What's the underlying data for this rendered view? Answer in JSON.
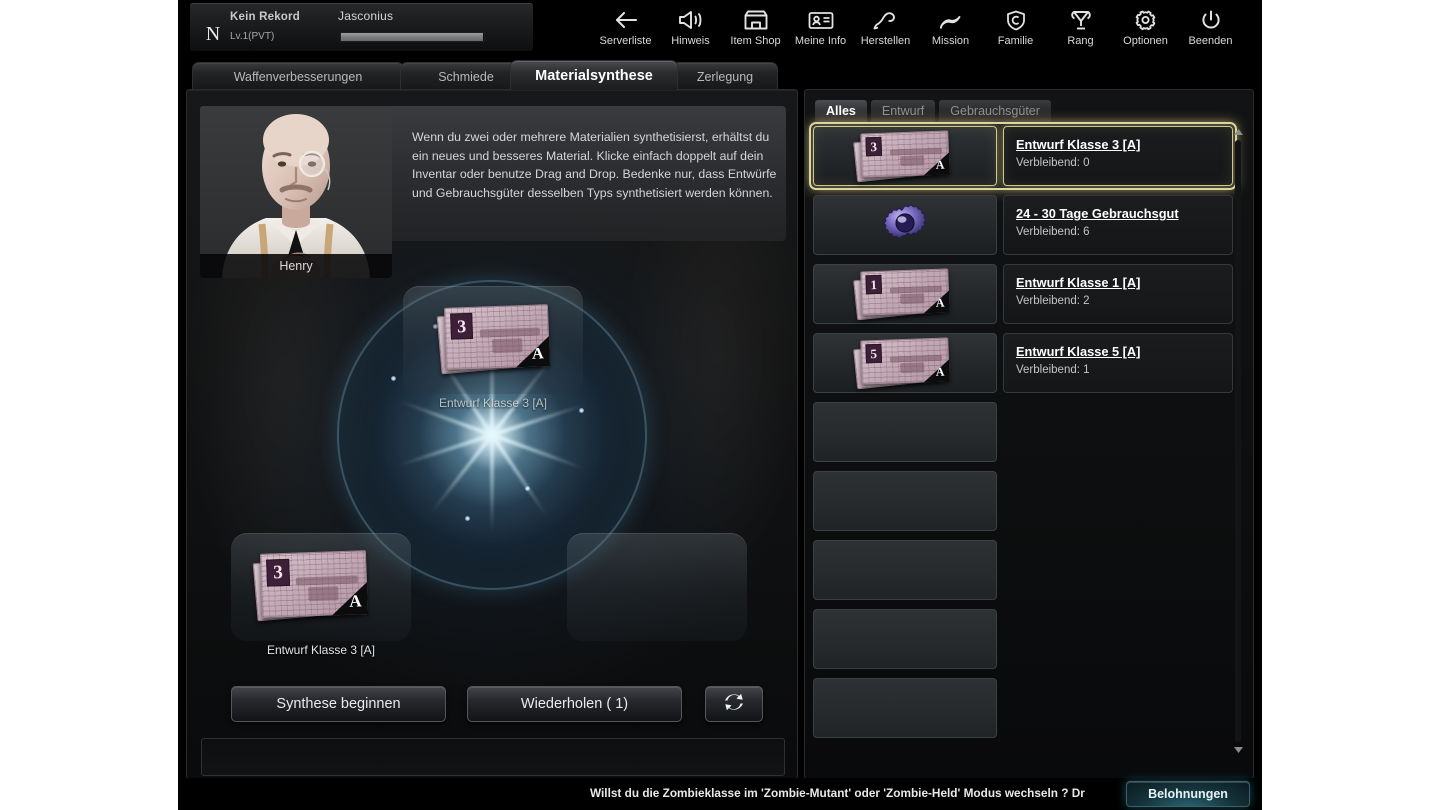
{
  "profile": {
    "rank_letter": "N",
    "record": "Kein Rekord",
    "level": "Lv.1(PVT)",
    "player_name": "Jasconius"
  },
  "nav": [
    {
      "icon": "back-arrow-icon",
      "label": "Serverliste"
    },
    {
      "icon": "megaphone-icon",
      "label": "Hinweis"
    },
    {
      "icon": "shop-icon",
      "label": "Item Shop"
    },
    {
      "icon": "id-card-icon",
      "label": "Meine Info"
    },
    {
      "icon": "hammer-icon",
      "label": "Herstellen"
    },
    {
      "icon": "flag-icon",
      "label": "Mission"
    },
    {
      "icon": "shield-c-icon",
      "label": "Familie"
    },
    {
      "icon": "trophy-icon",
      "label": "Rang"
    },
    {
      "icon": "gear-icon",
      "label": "Optionen"
    },
    {
      "icon": "power-icon",
      "label": "Beenden"
    }
  ],
  "tabs": [
    {
      "label": "Waffenverbesserungen",
      "active": false
    },
    {
      "label": "Schmiede",
      "active": false
    },
    {
      "label": "Materialsynthese",
      "active": true
    },
    {
      "label": "Zerlegung",
      "active": false
    }
  ],
  "helper": {
    "name": "Henry",
    "text": "Wenn du zwei oder mehrere Materialien synthetisierst, erhältst du ein neues und besseres Material. Klicke einfach doppelt auf dein Inventar oder benutze Drag and Drop. Bedenke nur, dass Entwürfe und Gebrauchsgüter desselben Typs synthetisiert werden können."
  },
  "synthesis": {
    "result_slot": {
      "label": "Entwurf Klasse 3 [A]",
      "grade": "3",
      "corner": "A",
      "filled": true
    },
    "material_slot": {
      "label": "Entwurf Klasse 3 [A]",
      "grade": "3",
      "corner": "A",
      "filled": true
    },
    "empty_slot": {
      "label": "",
      "filled": false
    }
  },
  "buttons": {
    "start": "Synthese beginnen",
    "repeat": "Wiederholen ( 1)",
    "refresh_icon": "refresh-arrows-icon"
  },
  "inventory": {
    "filter_tabs": [
      {
        "label": "Alles",
        "active": true
      },
      {
        "label": "Entwurf",
        "active": false
      },
      {
        "label": "Gebrauchsgüter",
        "active": false
      }
    ],
    "items": [
      {
        "title": "Entwurf Klasse 3 [A]",
        "sub": "Verbleibend: 0",
        "icon": "blueprint-icon",
        "grade": "3",
        "corner": "A",
        "selected": true,
        "empty": false
      },
      {
        "title": "24 - 30 Tage Gebrauchsgut",
        "sub": "Verbleibend: 6",
        "icon": "gear-item-icon",
        "grade": "",
        "corner": "",
        "selected": false,
        "empty": false
      },
      {
        "title": "Entwurf Klasse 1 [A]",
        "sub": "Verbleibend: 2",
        "icon": "blueprint-icon",
        "grade": "1",
        "corner": "A",
        "selected": false,
        "empty": false
      },
      {
        "title": "Entwurf Klasse 5 [A]",
        "sub": "Verbleibend: 1",
        "icon": "blueprint-icon",
        "grade": "5",
        "corner": "A",
        "selected": false,
        "empty": false
      },
      {
        "title": "",
        "sub": "",
        "icon": "",
        "grade": "",
        "corner": "",
        "selected": false,
        "empty": true
      },
      {
        "title": "",
        "sub": "",
        "icon": "",
        "grade": "",
        "corner": "",
        "selected": false,
        "empty": true
      },
      {
        "title": "",
        "sub": "",
        "icon": "",
        "grade": "",
        "corner": "",
        "selected": false,
        "empty": true
      },
      {
        "title": "",
        "sub": "",
        "icon": "",
        "grade": "",
        "corner": "",
        "selected": false,
        "empty": true
      },
      {
        "title": "",
        "sub": "",
        "icon": "",
        "grade": "",
        "corner": "",
        "selected": false,
        "empty": true
      }
    ],
    "scroll_up_icon": "chevron-up-icon",
    "scroll_down_icon": "chevron-down-icon"
  },
  "ticker": {
    "message": "Willst du die Zombieklasse im 'Zombie-Mutant' oder 'Zombie-Held' Modus wechseln ? Dr",
    "reward_button": "Belohnungen"
  },
  "colors": {
    "accent_selected": "#ded5a0",
    "reward_glow": "#2da0be",
    "synthesis_glow": "#8fd4f0",
    "blueprint_paper": "#c3a9b5",
    "blueprint_numbox": "#3e1f38"
  }
}
